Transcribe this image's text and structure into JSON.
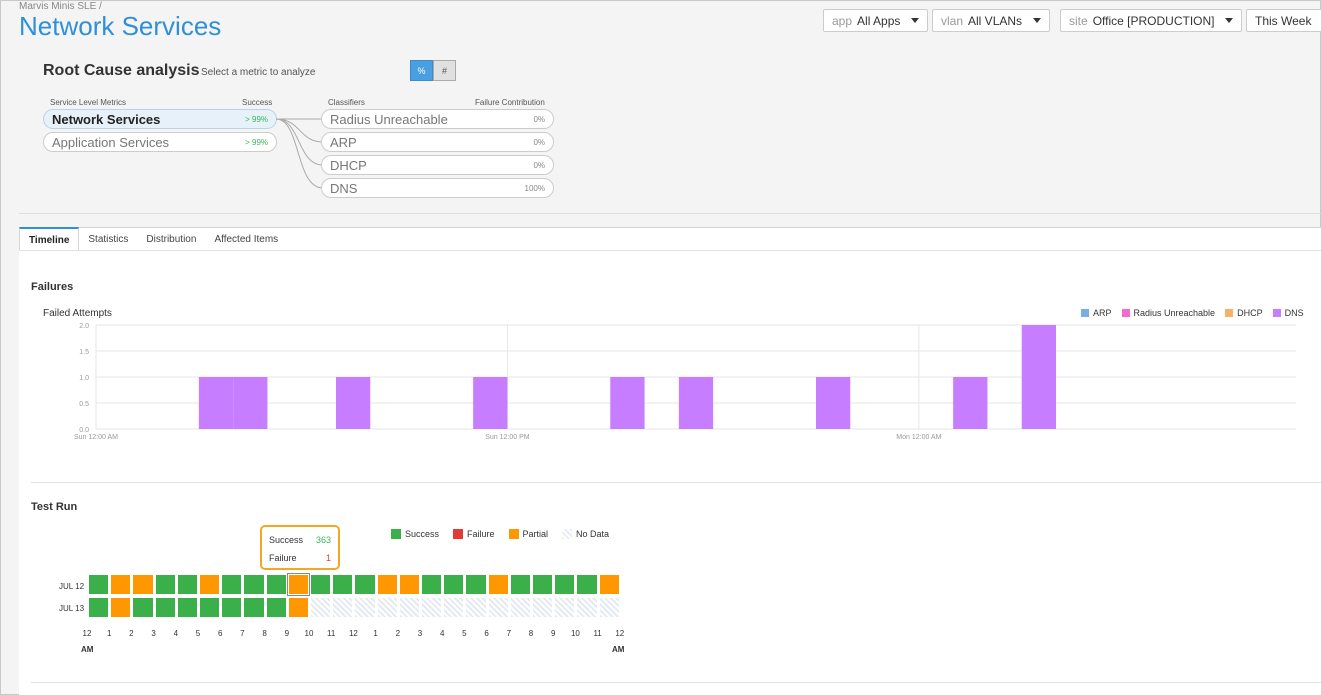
{
  "breadcrumb": "Marvis Minis SLE /",
  "page_title": "Network Services",
  "filters": [
    {
      "key": "app",
      "value": "All Apps"
    },
    {
      "key": "vlan",
      "value": "All VLANs"
    },
    {
      "key": "site",
      "value": "Office [PRODUCTION]"
    },
    {
      "key": "",
      "value": "This Week"
    }
  ],
  "root_cause": {
    "title": "Root Cause analysis",
    "subtitle": "Select a metric to analyze",
    "toggle": {
      "percent": "%",
      "count": "#"
    },
    "metrics_header": "Service Level Metrics",
    "success_header": "Success",
    "classifiers_header": "Classifiers",
    "failure_header": "Failure Contribution",
    "metrics": [
      {
        "label": "Network Services",
        "value": "> 99%"
      },
      {
        "label": "Application Services",
        "value": "> 99%"
      }
    ],
    "classifiers": [
      {
        "label": "Radius Unreachable",
        "value": "0%"
      },
      {
        "label": "ARP",
        "value": "0%"
      },
      {
        "label": "DHCP",
        "value": "0%"
      },
      {
        "label": "DNS",
        "value": "100%"
      }
    ]
  },
  "tabs": [
    "Timeline",
    "Statistics",
    "Distribution",
    "Affected Items"
  ],
  "failures": {
    "title": "Failures",
    "legend": [
      {
        "label": "ARP",
        "color": "#7aaee0"
      },
      {
        "label": "Radius Unreachable",
        "color": "#f06ad0"
      },
      {
        "label": "DHCP",
        "color": "#f7b267"
      },
      {
        "label": "DNS",
        "color": "#c77dff"
      }
    ]
  },
  "chart_data": {
    "type": "bar",
    "ylabel": "Failed Attempts",
    "ylim": [
      0,
      2
    ],
    "y_ticks": [
      "0.0",
      "0.5",
      "1.0",
      "1.5",
      "2.0"
    ],
    "x_ticks": [
      "Sun 12:00 AM",
      "Sun 12:00 PM",
      "Mon 12:00 AM"
    ],
    "x_tick_hours": [
      0,
      12,
      24
    ],
    "x_range_hours": [
      0,
      35
    ],
    "bar_width_hours": 1,
    "series": [
      {
        "name": "DNS",
        "color": "#c77dff",
        "points": [
          {
            "x": 3,
            "y": 1
          },
          {
            "x": 4,
            "y": 1
          },
          {
            "x": 7,
            "y": 1
          },
          {
            "x": 11,
            "y": 1
          },
          {
            "x": 15,
            "y": 1
          },
          {
            "x": 17,
            "y": 1
          },
          {
            "x": 21,
            "y": 1
          },
          {
            "x": 25,
            "y": 1
          },
          {
            "x": 27,
            "y": 2
          }
        ]
      }
    ]
  },
  "test_run": {
    "title": "Test Run",
    "tooltip": {
      "success_label": "Success",
      "success_value": "363",
      "failure_label": "Failure",
      "failure_value": "1"
    },
    "legend": [
      {
        "label": "Success",
        "color": "#3bb04a"
      },
      {
        "label": "Failure",
        "color": "#e53935"
      },
      {
        "label": "Partial",
        "color": "#ff9800"
      },
      {
        "label": "No Data",
        "color": "nodata"
      }
    ],
    "rows": [
      {
        "label": "JUL 12",
        "cells": [
          "S",
          "P",
          "P",
          "S",
          "S",
          "P",
          "S",
          "S",
          "S",
          "P",
          "S",
          "S",
          "S",
          "P",
          "P",
          "S",
          "S",
          "S",
          "P",
          "S",
          "S",
          "S",
          "S",
          "P"
        ]
      },
      {
        "label": "JUL 13",
        "cells": [
          "S",
          "P",
          "S",
          "S",
          "S",
          "S",
          "S",
          "S",
          "S",
          "P",
          "N",
          "N",
          "N",
          "N",
          "N",
          "N",
          "N",
          "N",
          "N",
          "N",
          "N",
          "N",
          "N",
          "N"
        ]
      }
    ],
    "hours": [
      "12",
      "1",
      "2",
      "3",
      "4",
      "5",
      "6",
      "7",
      "8",
      "9",
      "10",
      "11",
      "12",
      "1",
      "2",
      "3",
      "4",
      "5",
      "6",
      "7",
      "8",
      "9",
      "10",
      "11",
      "12"
    ],
    "am_label": "AM"
  }
}
